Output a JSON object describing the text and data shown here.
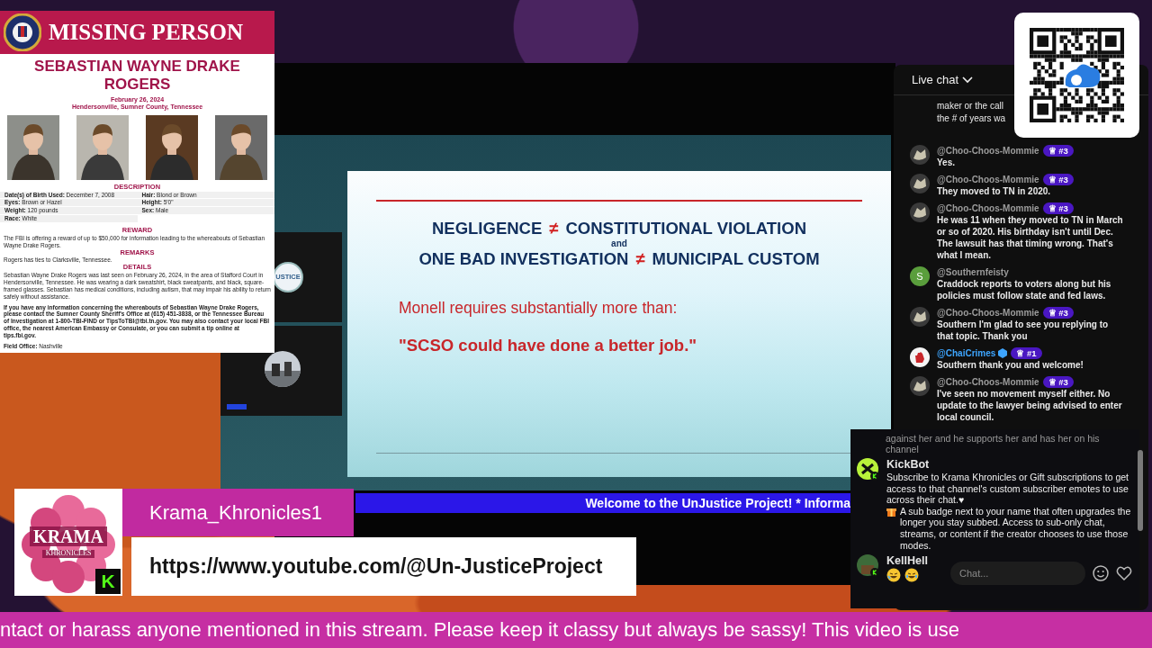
{
  "poster": {
    "title": "MISSING PERSON",
    "name": "SEBASTIAN WAYNE DRAKE ROGERS",
    "date": "February 26, 2024",
    "location": "Hendersonville, Sumner County, Tennessee",
    "description": {
      "heading": "DESCRIPTION",
      "fields": [
        "**Date(s) of Birth Used:** December 7, 2008",
        "**Hair:** Blond or Brown",
        "**Eyes:** Brown or Hazel",
        "**Height:** 5'0\"",
        "**Weight:** 120 pounds",
        "**Sex:** Male",
        "**Race:** White"
      ]
    },
    "reward": {
      "heading": "REWARD",
      "text": "The FBI is offering a reward of up to $50,000 for information leading to the whereabouts of Sebastian Wayne Drake Rogers."
    },
    "remarks": {
      "heading": "REMARKS",
      "text": "Rogers has ties to Clarksville, Tennessee."
    },
    "details": {
      "heading": "DETAILS",
      "paragraphs": [
        "Sebastian Wayne Drake Rogers was last seen on February 26, 2024, in the area of Stafford Court in Hendersonville, Tennessee. He was wearing a dark sweatshirt, black sweatpants, and black, square-framed glasses. Sebastian has medical conditions, including autism, that may impair his ability to return safely without assistance.",
        "**If you have any information concerning the whereabouts of Sebastian Wayne Drake Rogers, please contact the Sumner County Sheriff's Office at (615) 451-3838, or the Tennessee Bureau of Investigation at 1-800-TBI-FIND or TipsToTBI@tbi.tn.gov. You may also contact your local FBI office, the nearest American Embassy or Consulate, or you can submit a tip online at tips.fbi.gov.**",
        "**Field Office:** Nashville"
      ]
    }
  },
  "video": {
    "tiles": [
      {
        "kind": "logo",
        "label": "USTICE"
      },
      {
        "kind": "camera"
      }
    ],
    "slide": {
      "lines": [
        {
          "kind": "equation",
          "left": "NEGLIGENCE",
          "symbol": "≠",
          "right": "CONSTITUTIONAL VIOLATION"
        },
        {
          "kind": "connector",
          "text": "and"
        },
        {
          "kind": "equation",
          "left": "ONE BAD INVESTIGATION",
          "symbol": "≠",
          "right": "MUNICIPAL CUSTOM"
        }
      ],
      "intro": "Monell requires substantially more than:",
      "quote": "\"SCSO could have done a better job.\""
    },
    "ticker": "Welcome to the UnJustice Project! * Informa"
  },
  "live_chat": {
    "title": "Live chat",
    "placeholder": "Chat...",
    "messages": [
      {
        "kind": "cut",
        "lines": [
          "maker or the call",
          "the # of years wa"
        ]
      },
      {
        "kind": "message",
        "avatar": {
          "kind": "sketch"
        },
        "author": "@Choo-Choos-Mommie",
        "verified": false,
        "badge": "♕ #3",
        "text": "Yes."
      },
      {
        "kind": "message",
        "avatar": {
          "kind": "sketch"
        },
        "author": "@Choo-Choos-Mommie",
        "verified": false,
        "badge": "♕ #3",
        "text": "They moved to TN in 2020."
      },
      {
        "kind": "message",
        "avatar": {
          "kind": "sketch"
        },
        "author": "@Choo-Choos-Mommie",
        "verified": false,
        "badge": "♕ #3",
        "text": "He was 11 when they moved to TN in March or so of 2020. His birthday isn't until Dec. The lawsuit has that timing wrong. That's what I mean."
      },
      {
        "kind": "message",
        "avatar": {
          "kind": "letter",
          "letter": "S"
        },
        "author": "@Southernfeisty",
        "verified": false,
        "text": "Craddock reports to voters along but his policies must follow state and fed laws."
      },
      {
        "kind": "message",
        "avatar": {
          "kind": "sketch"
        },
        "author": "@Choo-Choos-Mommie",
        "verified": false,
        "badge": "♕ #3",
        "text": "Southern I'm glad to see you replying to that topic. Thank you"
      },
      {
        "kind": "message",
        "avatar": {
          "kind": "hand"
        },
        "author": "@ChaiCrimes",
        "verified": true,
        "badge": "♕ #1",
        "text": "Southern thank you and welcome!"
      },
      {
        "kind": "message",
        "avatar": {
          "kind": "sketch"
        },
        "author": "@Choo-Choos-Mommie",
        "verified": false,
        "badge": "♕ #3",
        "text": "I've seen no movement myself either. No update to the lawyer being advised to enter local council."
      }
    ]
  },
  "kick_chat": {
    "messages": [
      {
        "kind": "cut",
        "text": "against her and he supports her and has her on his channel"
      },
      {
        "kind": "bot",
        "author": "KickBot",
        "text_before": "Subscribe to Krama Khronicles or Gift subscriptions to get access to that channel's custom subscriber emotes to use across their chat.♥",
        "inline_emote": {
          "kind": "gift"
        },
        "text_after": "A sub badge next to your name that often upgrades the longer you stay subbed. Access to sub-only chat, streams, or content if the creator chooses to use those modes."
      },
      {
        "kind": "user",
        "author": "KellHell",
        "emotes": [
          {
            "kind": "rofl"
          },
          {
            "kind": "joy"
          }
        ]
      }
    ]
  },
  "nameplate": {
    "logo_title": "KRAMA",
    "logo_subtitle": "KHRONICLES",
    "platform_badge": "K",
    "channel": "Krama_Khronicles1",
    "url": "https://www.youtube.com/@Un-JusticeProject"
  },
  "crawler": {
    "text": "ntact or harass anyone mentioned in this stream. Please keep it classy but always be sassy! This video is use"
  }
}
